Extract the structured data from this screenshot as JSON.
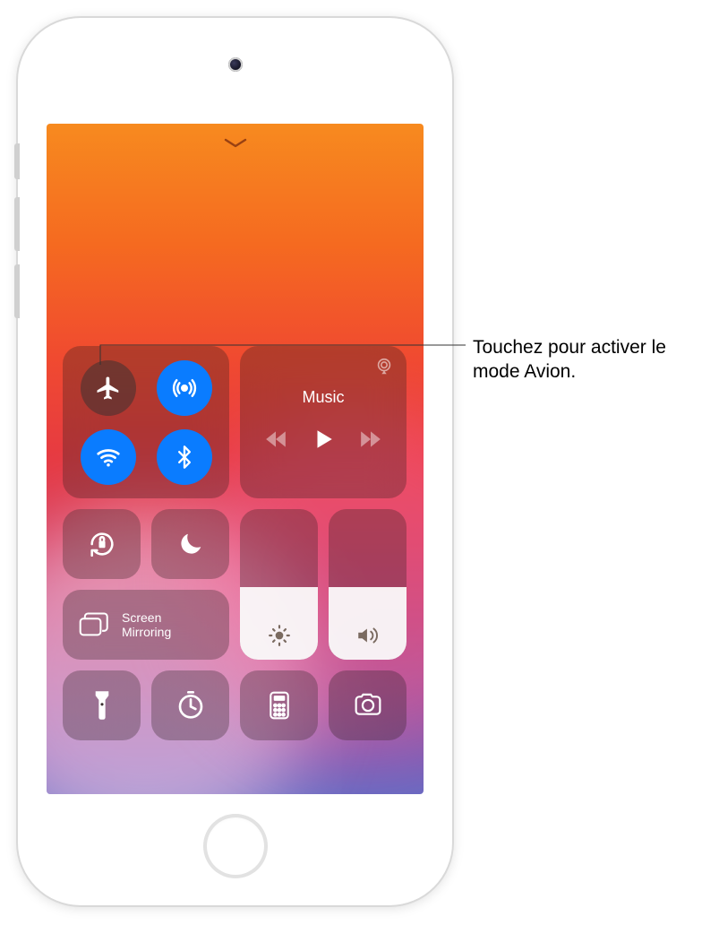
{
  "callout": {
    "text": "Touchez pour activer le mode Avion."
  },
  "control_center": {
    "connectivity": {
      "airplane": {
        "active": false
      },
      "airdrop": {
        "active": true
      },
      "wifi": {
        "active": true
      },
      "bluetooth": {
        "active": true
      }
    },
    "music": {
      "title": "Music"
    },
    "screen_mirroring": {
      "label": "Screen\nMirroring"
    },
    "sliders": {
      "brightness": {
        "value_pct": 48
      },
      "volume": {
        "value_pct": 48
      }
    },
    "shortcuts": {
      "flashlight": "flashlight",
      "timer": "timer",
      "calculator": "calculator",
      "camera": "camera"
    }
  },
  "colors": {
    "active_toggle": "#0a7cff"
  }
}
